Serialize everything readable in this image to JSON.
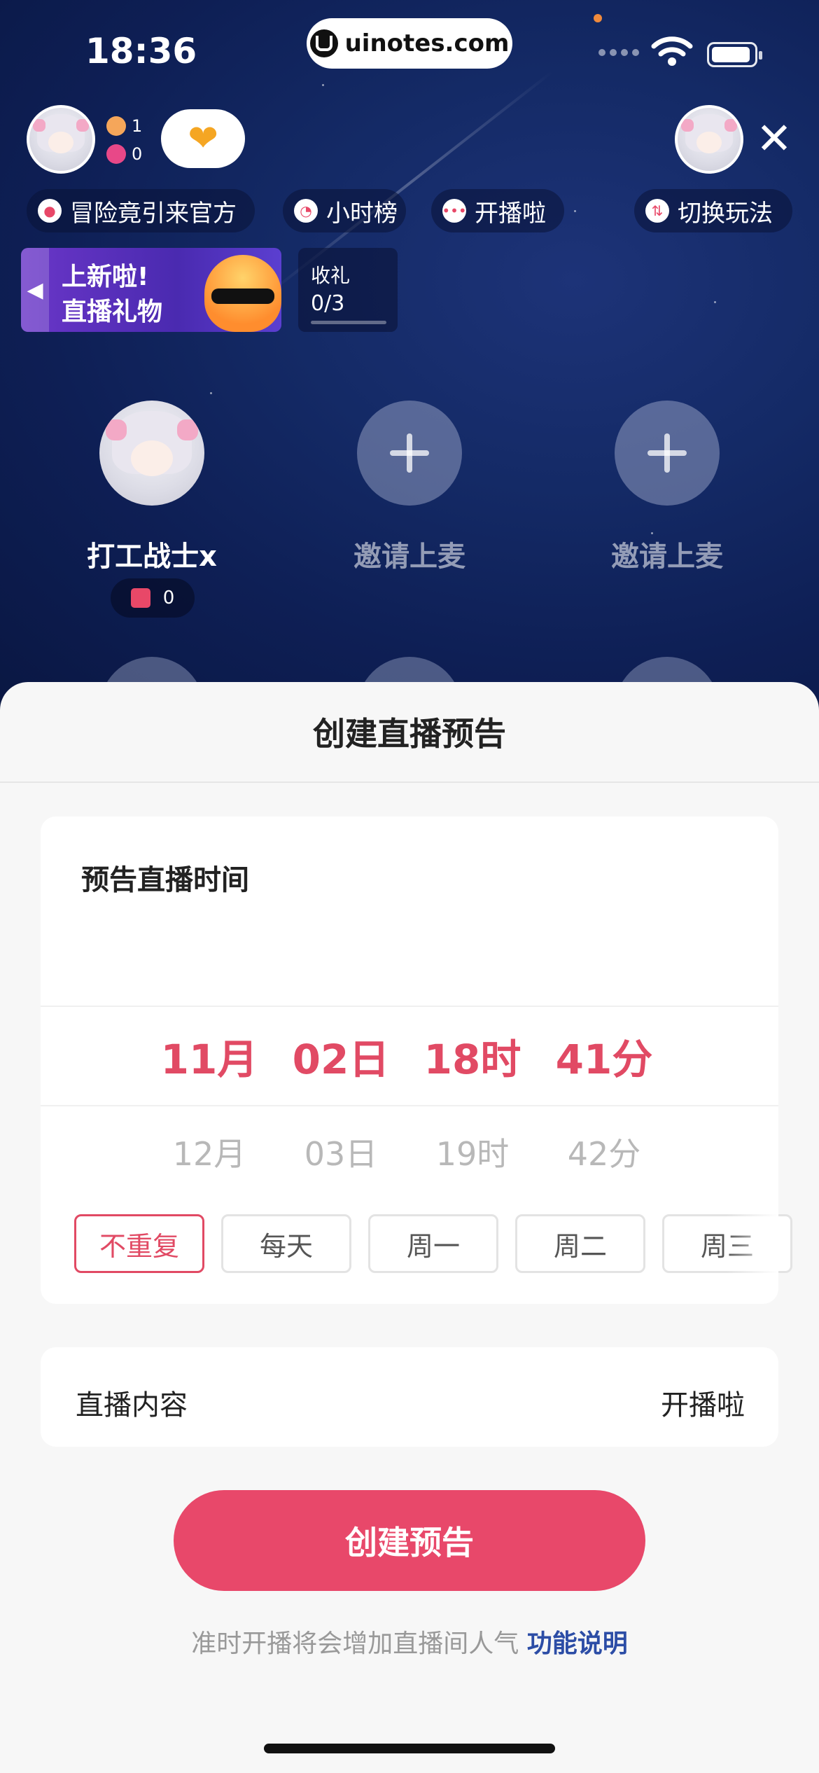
{
  "status_bar": {
    "time": "18:36",
    "url": "uinotes.com"
  },
  "host": {
    "user_count": "1",
    "like_count": "0"
  },
  "chips": {
    "adventure": "冒险竟引来官方",
    "hour_rank": "小时榜",
    "kaibo": "开播啦",
    "switch_mode": "切换玩法"
  },
  "banner": {
    "line1": "上新啦!",
    "line2": "直播礼物"
  },
  "gift_task": {
    "label": "收礼",
    "progress": "0/3"
  },
  "seats": [
    {
      "name": "打工战士x",
      "gifts": "0"
    },
    {
      "name": "邀请上麦"
    },
    {
      "name": "邀请上麦"
    }
  ],
  "sheet": {
    "title": "创建直播预告",
    "time_label": "预告直播时间",
    "picker_selected": [
      "11月",
      "02日",
      "18时",
      "41分"
    ],
    "picker_next": [
      "12月",
      "03日",
      "19时",
      "42分"
    ],
    "repeat_options": [
      "不重复",
      "每天",
      "周一",
      "周二",
      "周三"
    ],
    "content_label": "直播内容",
    "content_value": "开播啦",
    "create_button": "创建预告",
    "hint_text": "准时开播将会增加直播间人气",
    "hint_link": "功能说明"
  },
  "colors": {
    "accent": "#e8486a",
    "link": "#2c4da6",
    "background_top": "#142a66"
  }
}
